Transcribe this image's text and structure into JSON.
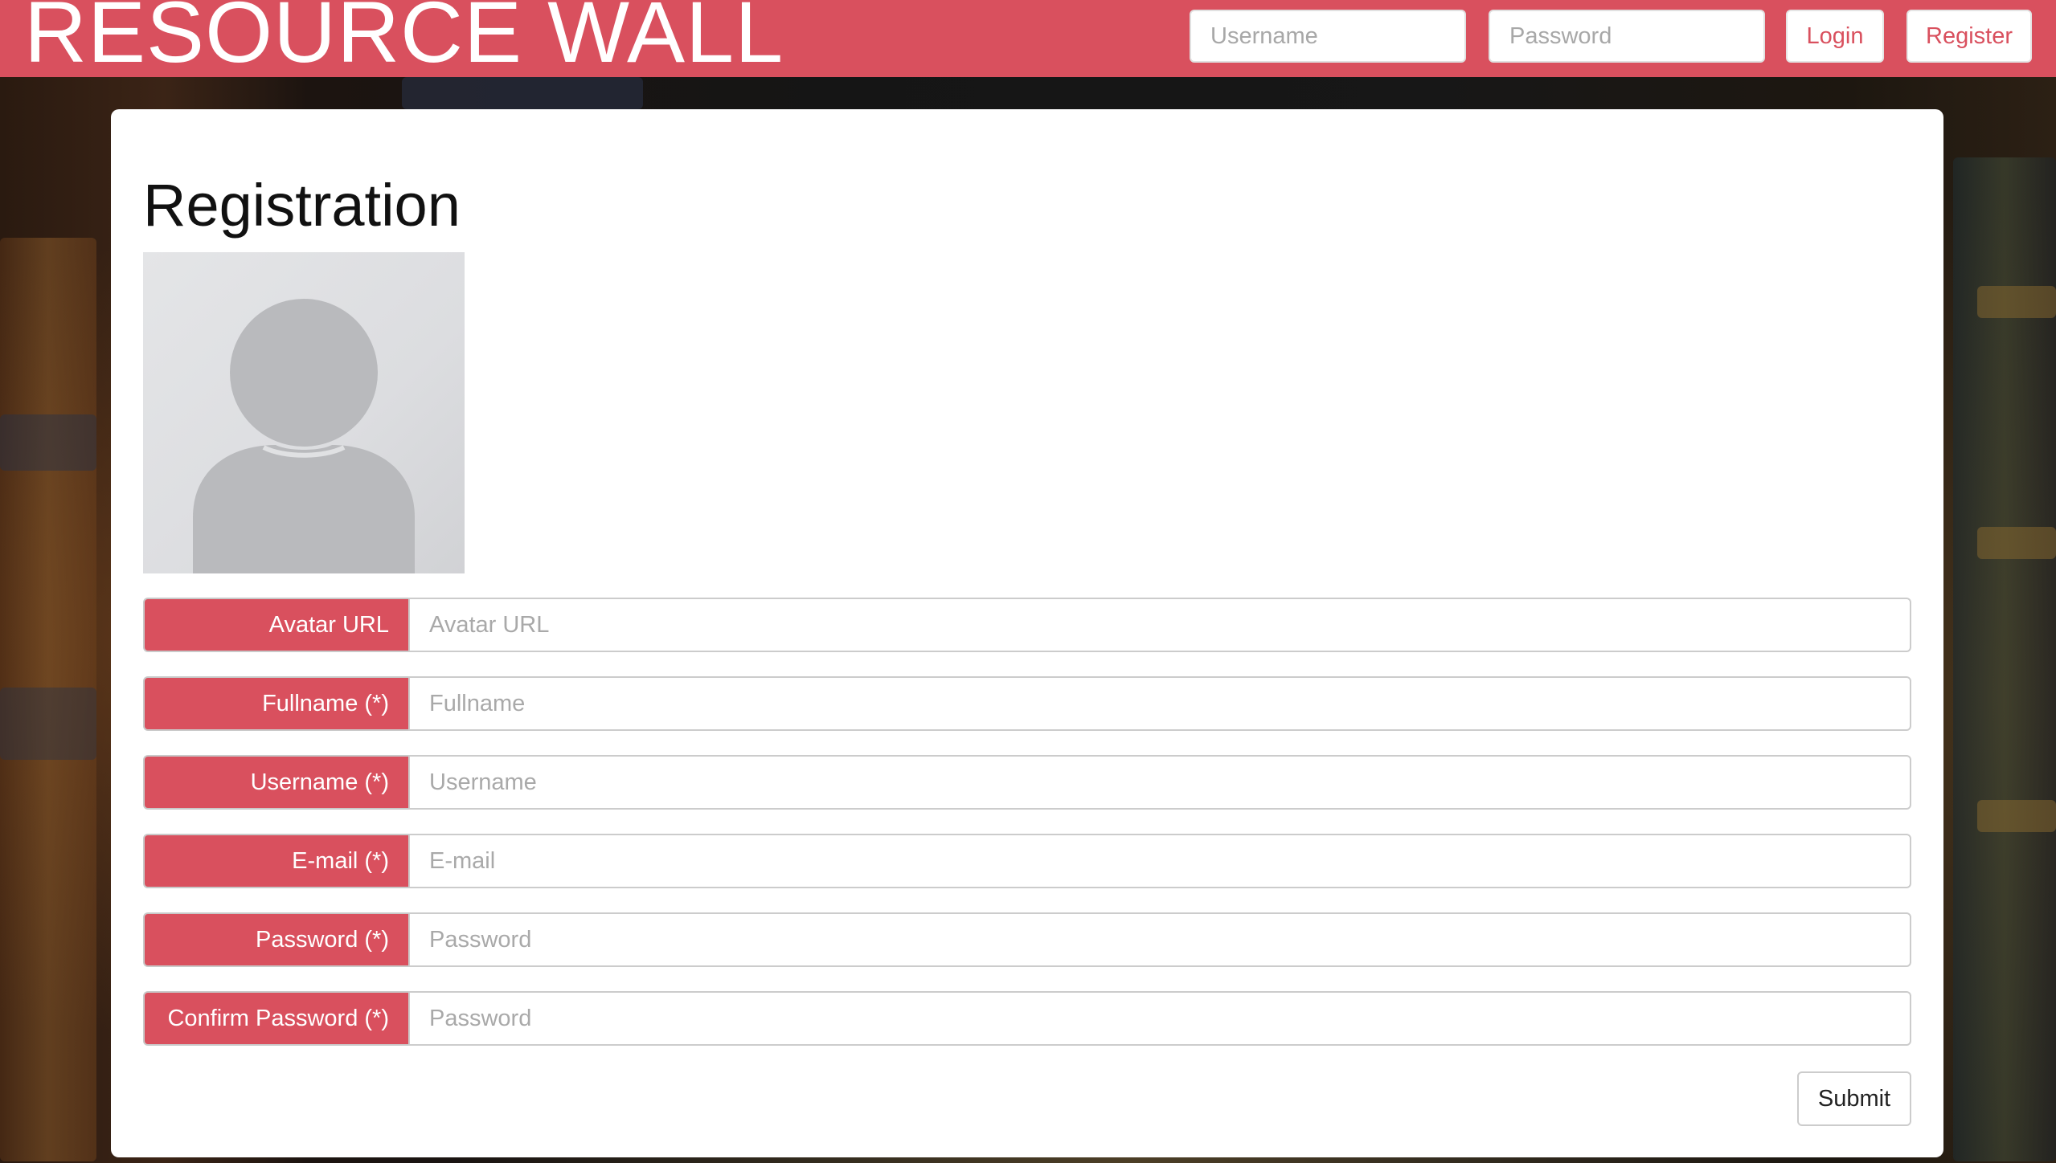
{
  "header": {
    "brand": "RESOURCE WALL",
    "username_placeholder": "Username",
    "password_placeholder": "Password",
    "login_label": "Login",
    "register_label": "Register"
  },
  "colors": {
    "accent": "#d9505e",
    "card_background": "#ffffff",
    "page_background": "#171717"
  },
  "main": {
    "title": "Registration",
    "avatar_icon": "default-user-avatar",
    "fields": [
      {
        "label": "Avatar URL",
        "placeholder": "Avatar URL",
        "value": ""
      },
      {
        "label": "Fullname (*)",
        "placeholder": "Fullname",
        "value": ""
      },
      {
        "label": "Username (*)",
        "placeholder": "Username",
        "value": ""
      },
      {
        "label": "E-mail (*)",
        "placeholder": "E-mail",
        "value": ""
      },
      {
        "label": "Password (*)",
        "placeholder": "Password",
        "value": ""
      },
      {
        "label": "Confirm Password (*)",
        "placeholder": "Password",
        "value": ""
      }
    ],
    "submit_label": "Submit"
  }
}
